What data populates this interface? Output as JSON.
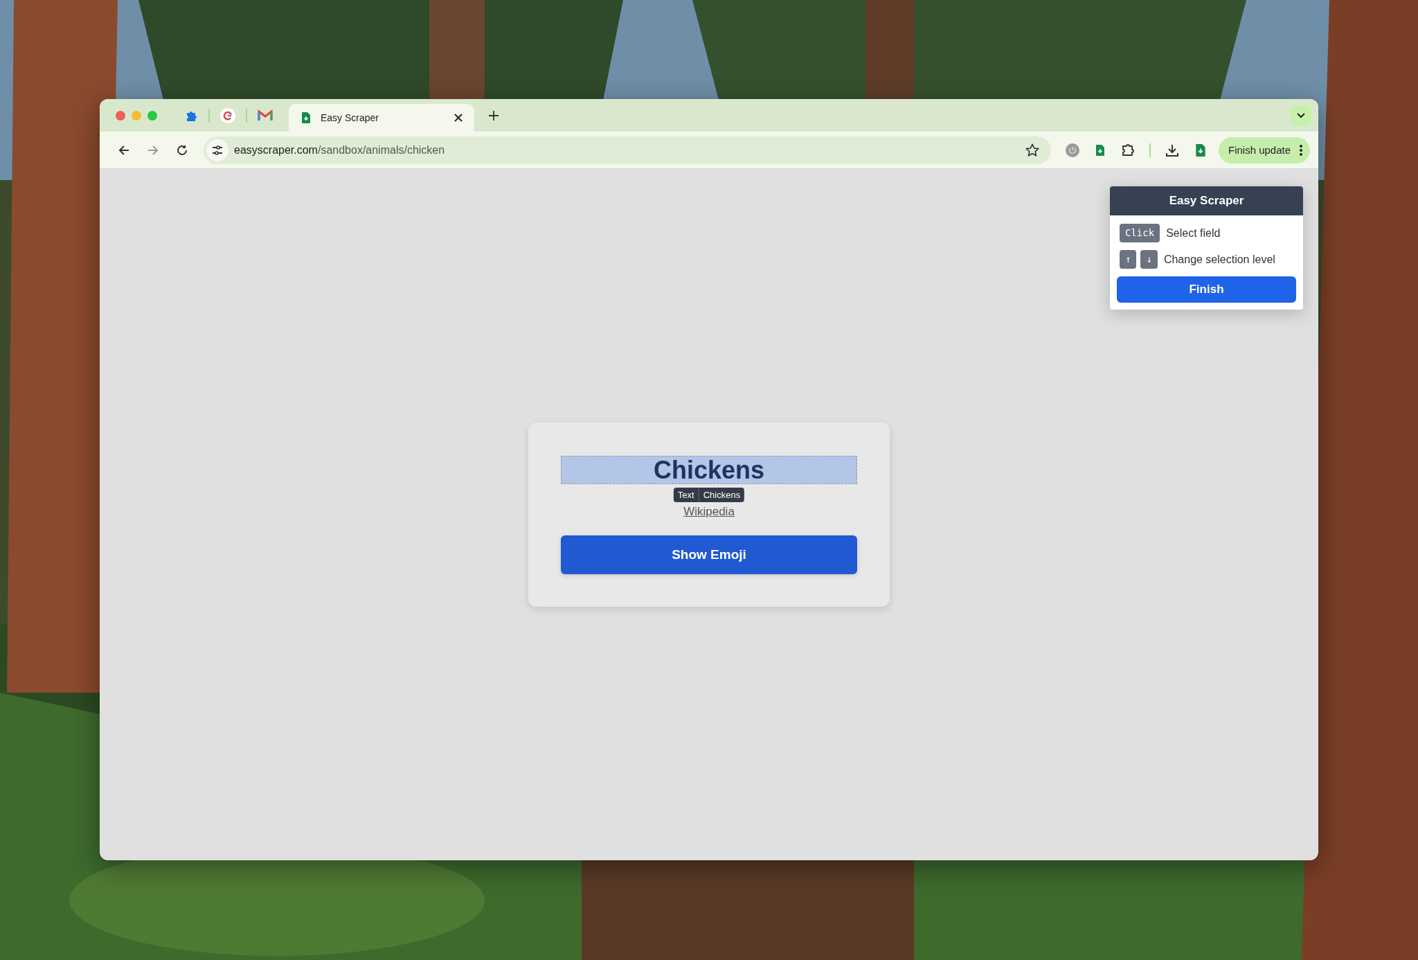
{
  "browser": {
    "tabs": [
      {
        "title": "Easy Scraper",
        "selected": true
      }
    ],
    "address": {
      "host": "easyscraper.com",
      "path": "/sandbox/animals/chicken"
    },
    "update_button": "Finish update"
  },
  "scraper_panel": {
    "title": "Easy Scraper",
    "hints": [
      {
        "keys": [
          "Click"
        ],
        "label": "Select field"
      },
      {
        "keys": [
          "↑",
          "↓"
        ],
        "label": "Change selection level"
      }
    ],
    "finish": "Finish"
  },
  "page": {
    "heading": {
      "text": "Chickens",
      "selected": true,
      "tooltip": [
        "Text",
        "Chickens"
      ]
    },
    "link": "Wikipedia",
    "button": "Show Emoji"
  }
}
